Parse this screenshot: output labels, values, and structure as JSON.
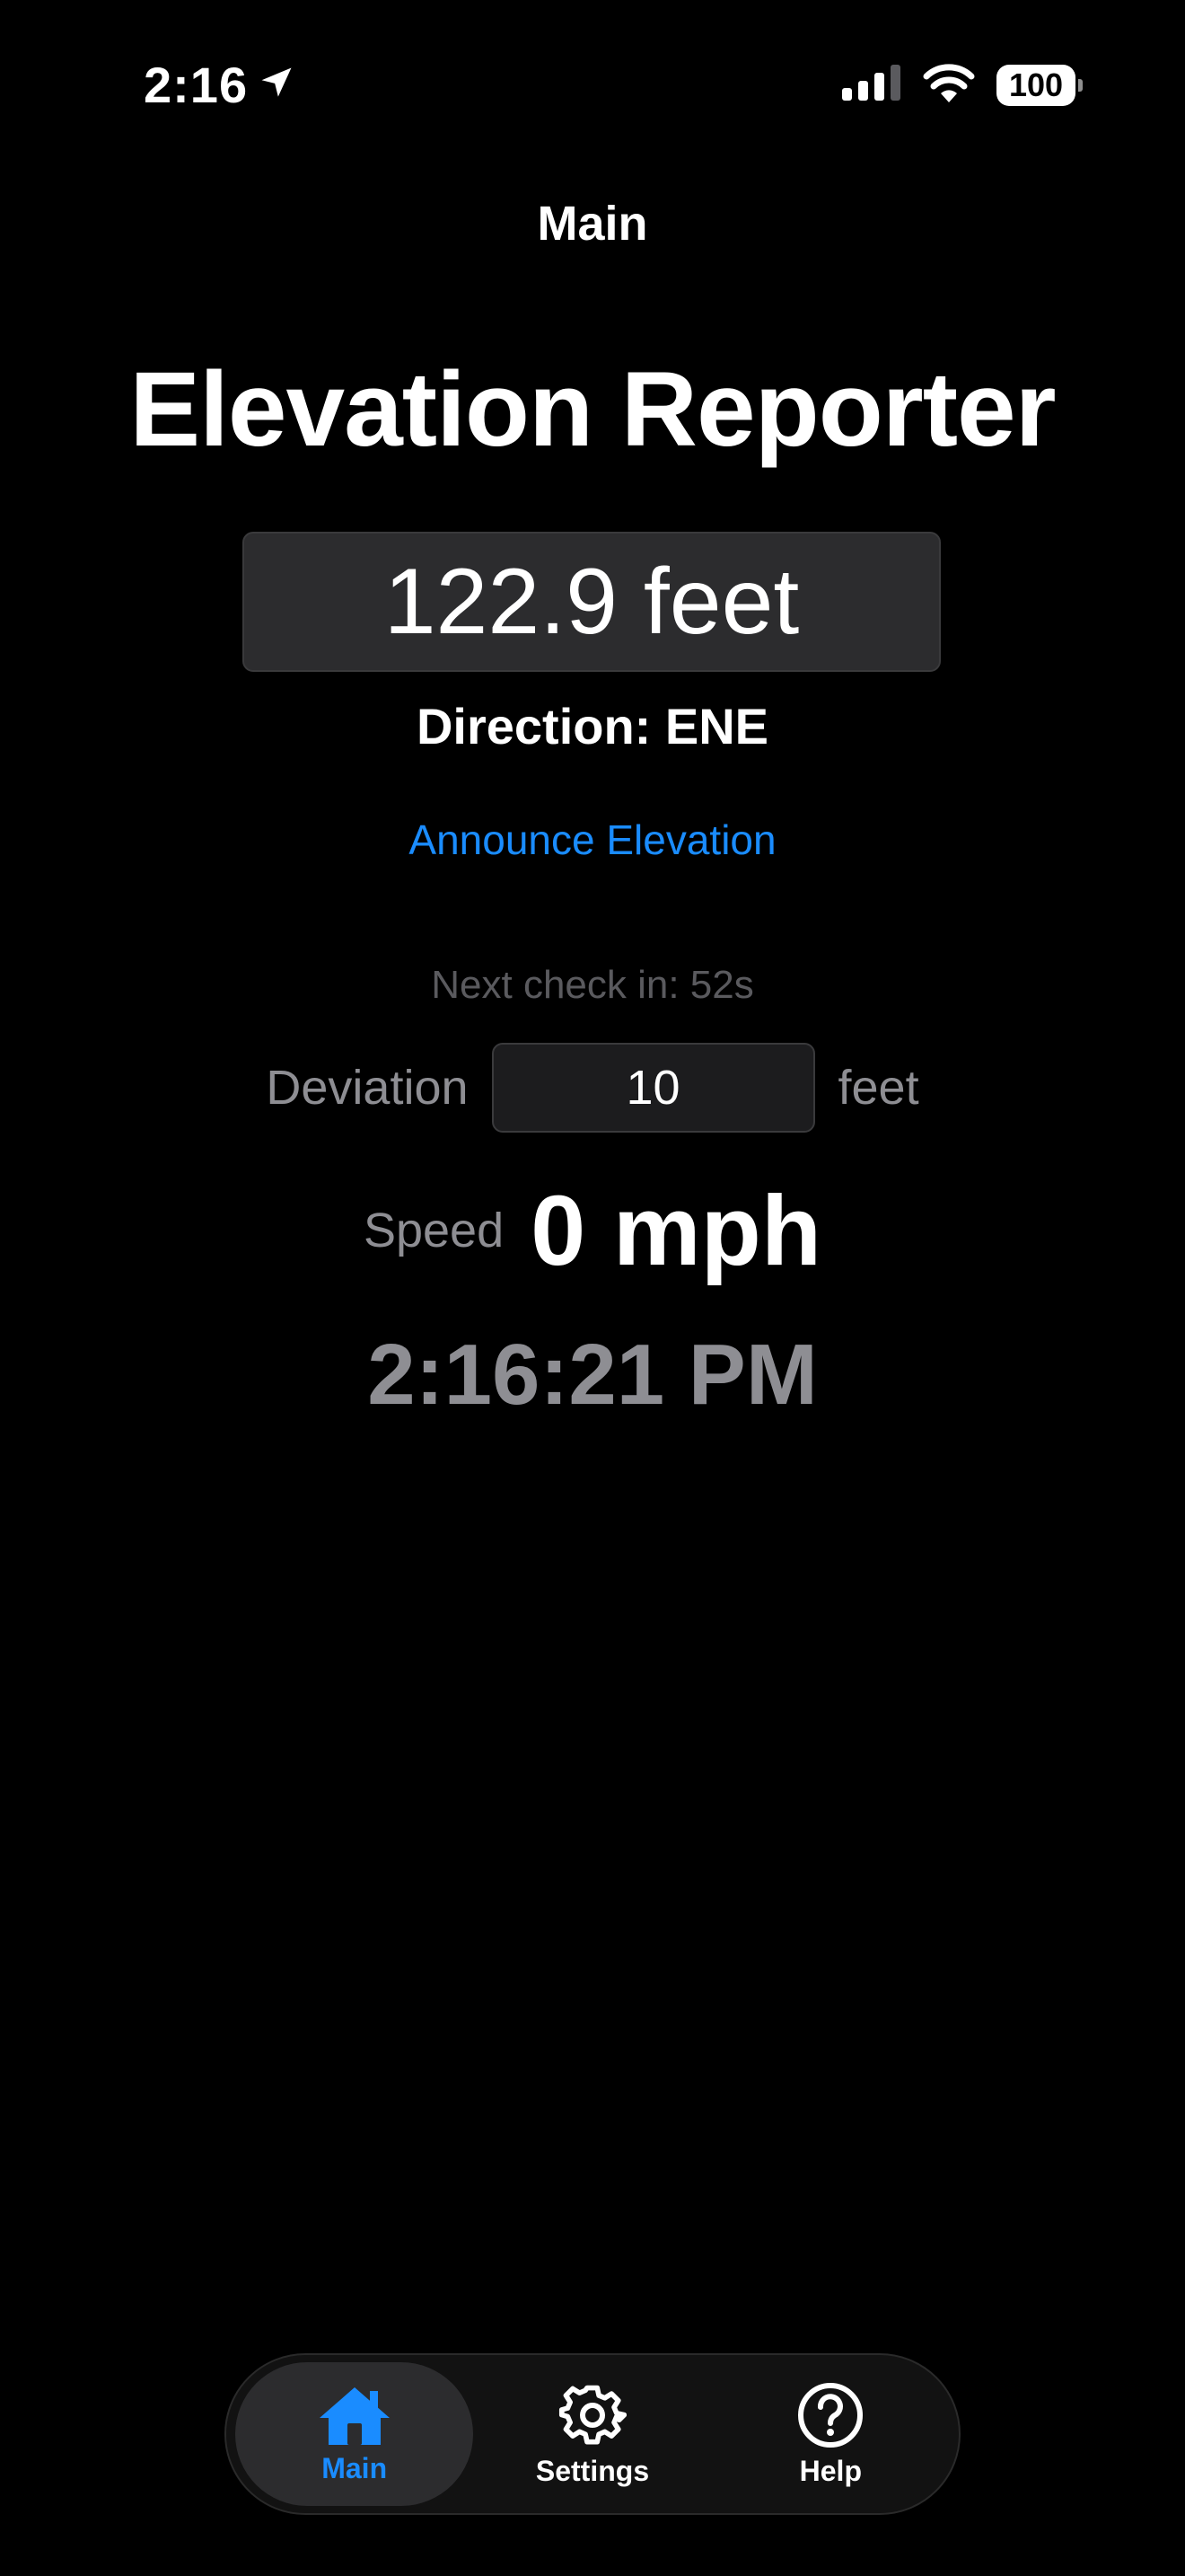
{
  "status_bar": {
    "time": "2:16",
    "battery": "100"
  },
  "nav": {
    "title": "Main"
  },
  "main": {
    "app_title": "Elevation Reporter",
    "elevation": "122.9 feet",
    "direction": "Direction: ENE",
    "announce_label": "Announce Elevation",
    "next_check": "Next check in: 52s",
    "deviation_label": "Deviation",
    "deviation_value": "10",
    "deviation_unit": "feet",
    "speed_label": "Speed",
    "speed_value": "0 mph",
    "clock": "2:16:21 PM"
  },
  "tabs": [
    {
      "label": "Main",
      "icon": "house-icon",
      "active": true
    },
    {
      "label": "Settings",
      "icon": "gear-icon",
      "active": false
    },
    {
      "label": "Help",
      "icon": "question-circle-icon",
      "active": false
    }
  ],
  "colors": {
    "accent": "#1a8cff",
    "background": "#000000",
    "secondary_text": "#8e8e93"
  }
}
